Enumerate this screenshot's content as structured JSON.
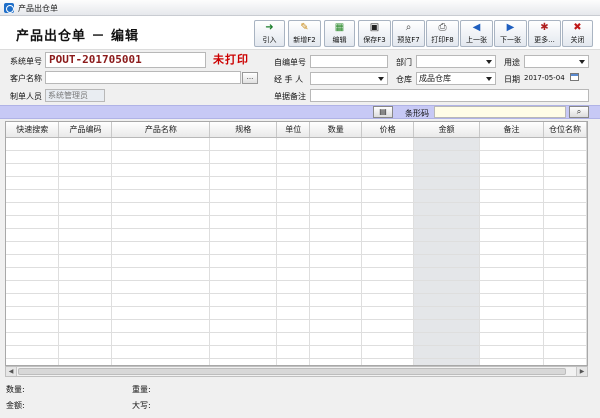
{
  "window": {
    "title": "产品出仓单"
  },
  "header": {
    "title": "产品出仓单 － 编辑"
  },
  "toolbar": {
    "import": "引入",
    "new": "新增F2",
    "edit": "编辑",
    "save": "保存F3",
    "preview": "预览F7",
    "print": "打印F8",
    "prev": "上一张",
    "next": "下一张",
    "more": "更多...",
    "close": "关闭"
  },
  "form": {
    "system_no_label": "系统单号",
    "system_no_value": "POUT-201705001",
    "status": "未打印",
    "customer_label": "客户名称",
    "customer_btn": "...",
    "creator_label": "制单人员",
    "creator_value": "系统管理员",
    "self_no_label": "自编单号",
    "handler_label": "经 手 人",
    "doc_note_label": "单据备注",
    "dept_label": "部门",
    "warehouse_label": "仓库",
    "warehouse_value": "成品仓库",
    "usage_label": "用途",
    "date_label": "日期",
    "date_value": "2017-05-04"
  },
  "barcode": {
    "label": "条形码"
  },
  "grid": {
    "columns": [
      "快速搜索",
      "产品编码",
      "产品名称",
      "规格",
      "单位",
      "数量",
      "价格",
      "金额",
      "备注",
      "仓位名称"
    ],
    "row_count": 18
  },
  "footer": {
    "qty_label": "数量:",
    "weight_label": "重量:",
    "amount_label": "金额:",
    "upper_label": "大写:"
  },
  "icons": {
    "import": "arrow-right-icon",
    "new": "new-doc-icon",
    "edit": "edit-icon",
    "save": "floppy-icon",
    "preview": "preview-icon",
    "print": "printer-icon",
    "prev": "arrow-left-icon",
    "next": "arrow-right-icon",
    "more": "more-icon",
    "close": "close-icon"
  },
  "colors": {
    "accent_status": "#cc0000",
    "doc_no": "#8b1a1a",
    "barcode_strip": "#c7c9f5",
    "barcode_input": "#fffde7"
  }
}
